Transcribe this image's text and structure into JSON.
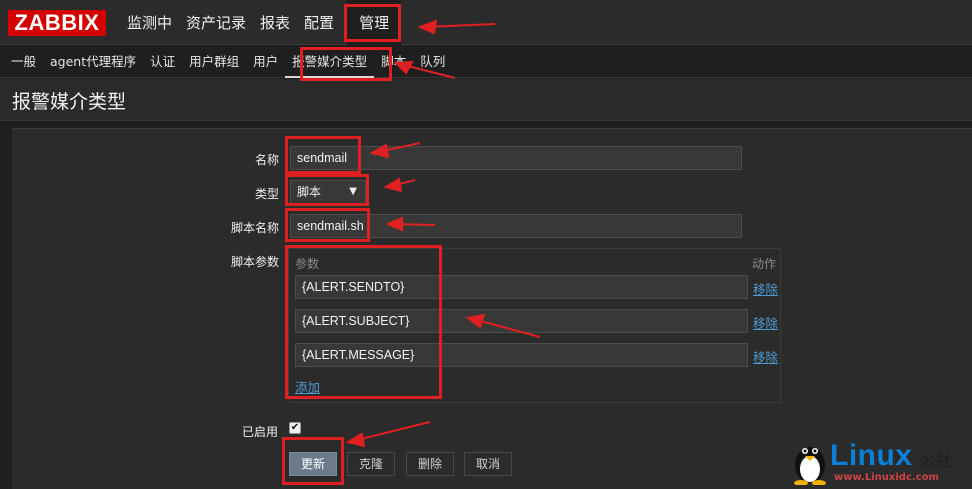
{
  "brand": {
    "logo": "ZABBIX"
  },
  "main_nav": [
    {
      "label": "监测中"
    },
    {
      "label": "资产记录"
    },
    {
      "label": "报表"
    },
    {
      "label": "配置"
    },
    {
      "label": "管理"
    }
  ],
  "sub_nav": [
    {
      "label": "一般"
    },
    {
      "label": "agent代理程序"
    },
    {
      "label": "认证"
    },
    {
      "label": "用户群组"
    },
    {
      "label": "用户"
    },
    {
      "label": "报警媒介类型"
    },
    {
      "label": "脚本"
    },
    {
      "label": "队列"
    }
  ],
  "page": {
    "title": "报警媒介类型"
  },
  "form": {
    "name_label": "名称",
    "name_value": "sendmail",
    "type_label": "类型",
    "type_value": "脚本",
    "script_name_label": "脚本名称",
    "script_name_value": "sendmail.sh",
    "script_params_label": "脚本参数",
    "params_header": "参数",
    "action_header": "动作",
    "params": [
      {
        "value": "{ALERT.SENDTO}",
        "remove": "移除"
      },
      {
        "value": "{ALERT.SUBJECT}",
        "remove": "移除"
      },
      {
        "value": "{ALERT.MESSAGE}",
        "remove": "移除"
      }
    ],
    "add_link": "添加",
    "enabled_label": "已启用",
    "enabled": true
  },
  "buttons": {
    "update": "更新",
    "clone": "克隆",
    "delete": "删除",
    "cancel": "取消"
  },
  "watermark": {
    "brand": "Linux",
    "brand_suffix": "公社",
    "url": "www.Linuxidc.com"
  },
  "colors": {
    "logo_bg": "#d40000",
    "annotation": "#e02020",
    "link": "#4e9cd4",
    "primary_button": "#6b7b8c"
  }
}
